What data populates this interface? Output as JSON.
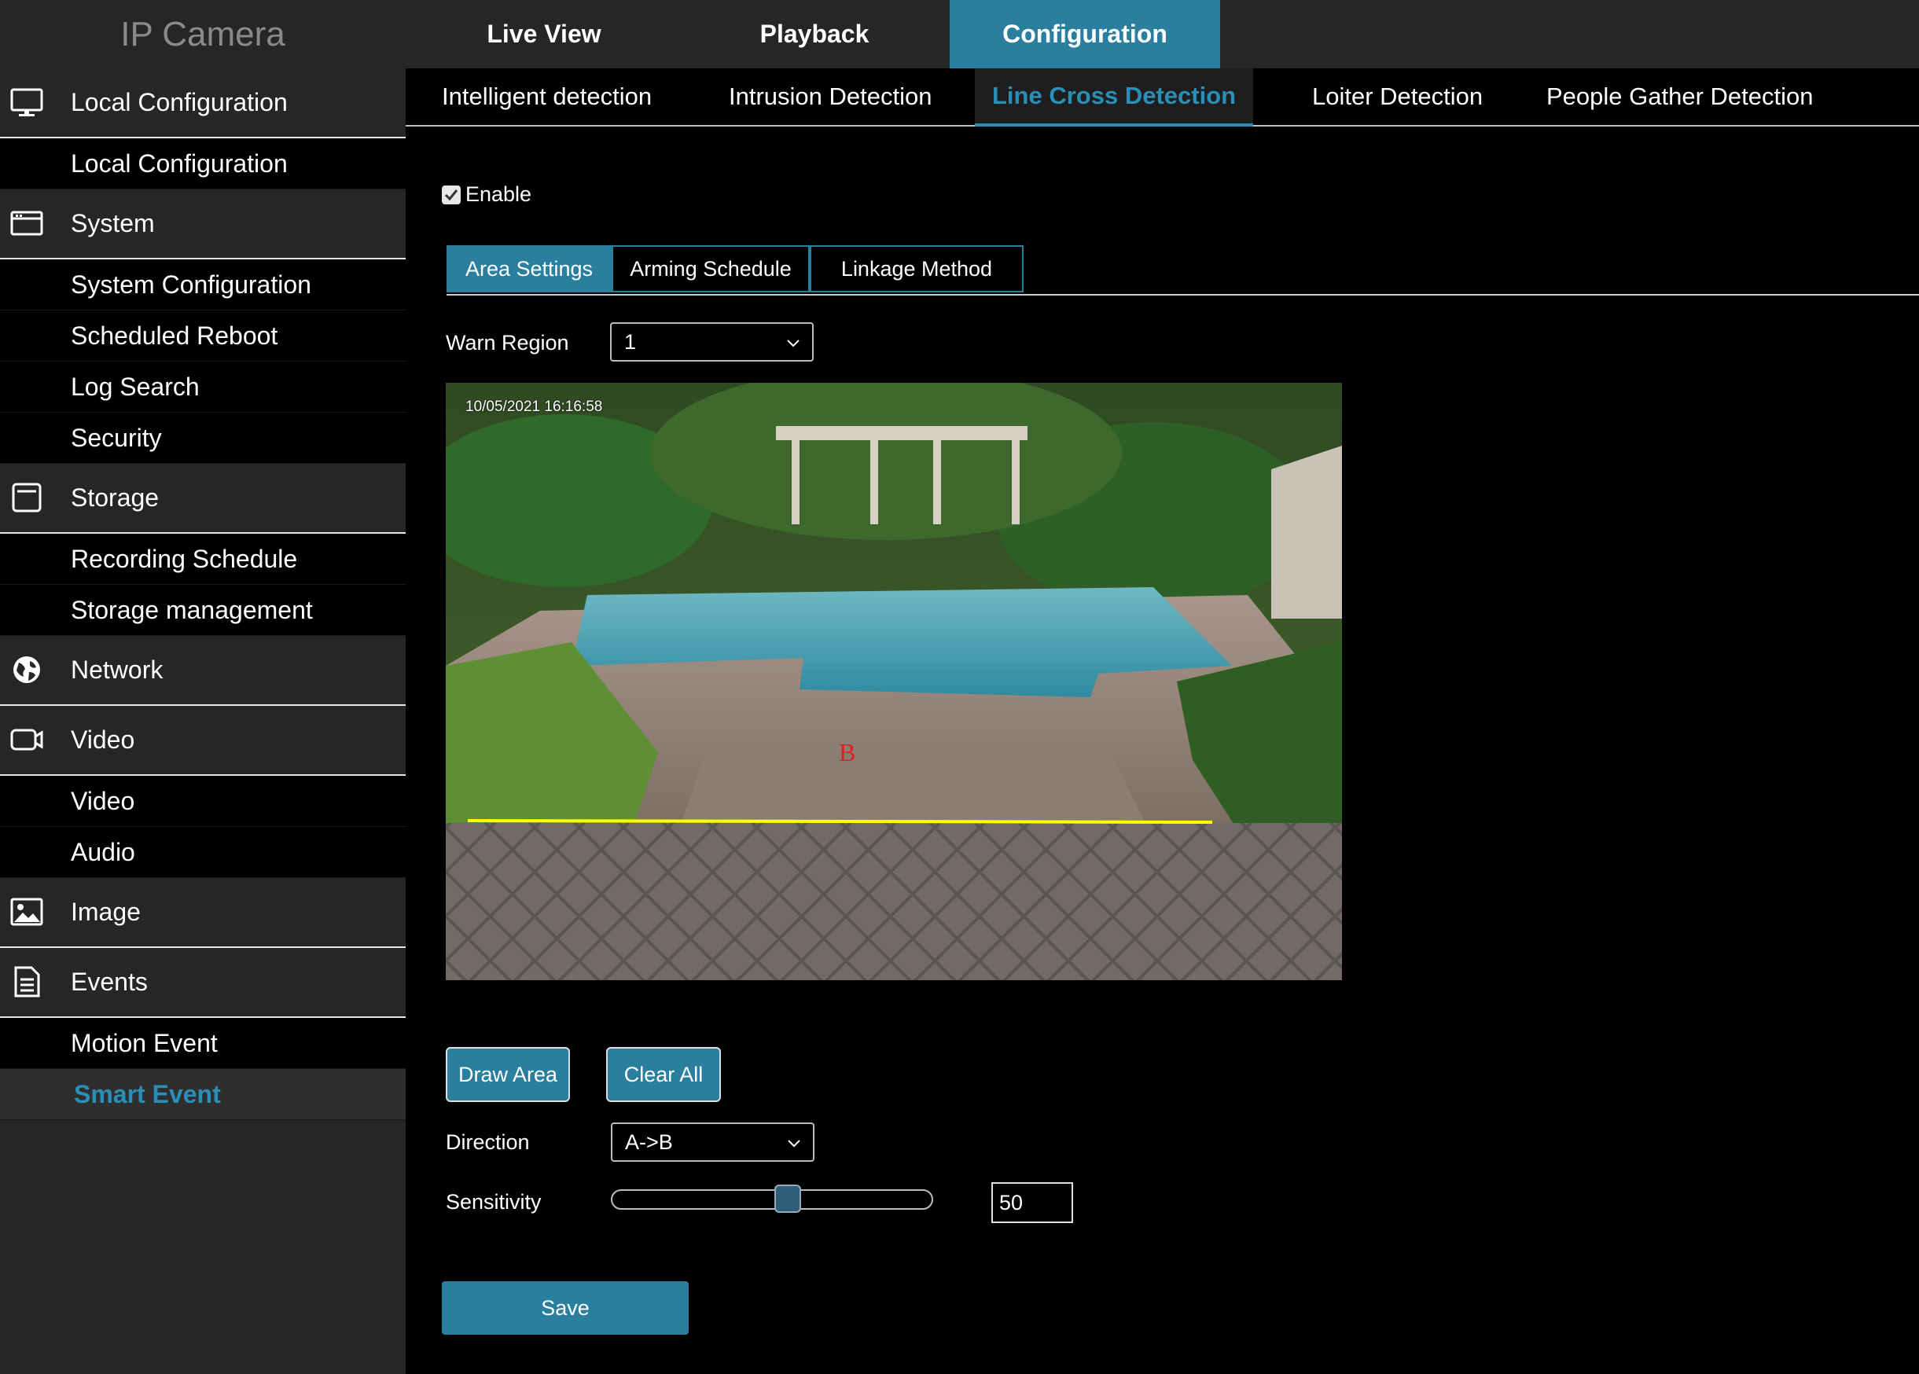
{
  "app": {
    "title": "IP Camera"
  },
  "main_nav": [
    {
      "label": "Live View"
    },
    {
      "label": "Playback"
    },
    {
      "label": "Configuration"
    }
  ],
  "sidebar": {
    "sections": [
      {
        "label": "Local Configuration",
        "icon": "monitor-icon",
        "items": [
          "Local Configuration"
        ]
      },
      {
        "label": "System",
        "icon": "system-window-icon",
        "items": [
          "System Configuration",
          "Scheduled Reboot",
          "Log Search",
          "Security"
        ]
      },
      {
        "label": "Storage",
        "icon": "storage-icon",
        "items": [
          "Recording Schedule",
          "Storage management"
        ]
      },
      {
        "label": "Network",
        "icon": "globe-icon",
        "items": []
      },
      {
        "label": "Video",
        "icon": "camera-icon",
        "items": [
          "Video",
          "Audio"
        ]
      },
      {
        "label": "Image",
        "icon": "image-icon",
        "items": []
      },
      {
        "label": "Events",
        "icon": "document-icon",
        "items": [
          "Motion Event",
          "Smart Event"
        ]
      }
    ],
    "active_item": "Smart Event"
  },
  "sub_nav": [
    {
      "label": "Intelligent detection"
    },
    {
      "label": "Intrusion Detection"
    },
    {
      "label": "Line Cross Detection"
    },
    {
      "label": "Loiter Detection"
    },
    {
      "label": "People Gather Detection"
    }
  ],
  "enable": {
    "label": "Enable",
    "checked": true
  },
  "content_tabs": [
    {
      "label": "Area Settings"
    },
    {
      "label": "Arming Schedule"
    },
    {
      "label": "Linkage Method"
    }
  ],
  "warn_region": {
    "label": "Warn Region",
    "value": "1"
  },
  "video": {
    "timestamp": "10/05/2021  16:16:58",
    "line_marker": "B"
  },
  "buttons": {
    "draw_area": "Draw Area",
    "clear_all": "Clear All",
    "save": "Save"
  },
  "direction": {
    "label": "Direction",
    "value": "A->B"
  },
  "sensitivity": {
    "label": "Sensitivity",
    "value": "50",
    "fraction": 0.5
  },
  "colors": {
    "accent": "#2a7f9e",
    "active_text": "#2a8fb8",
    "line": "#ffff00"
  }
}
